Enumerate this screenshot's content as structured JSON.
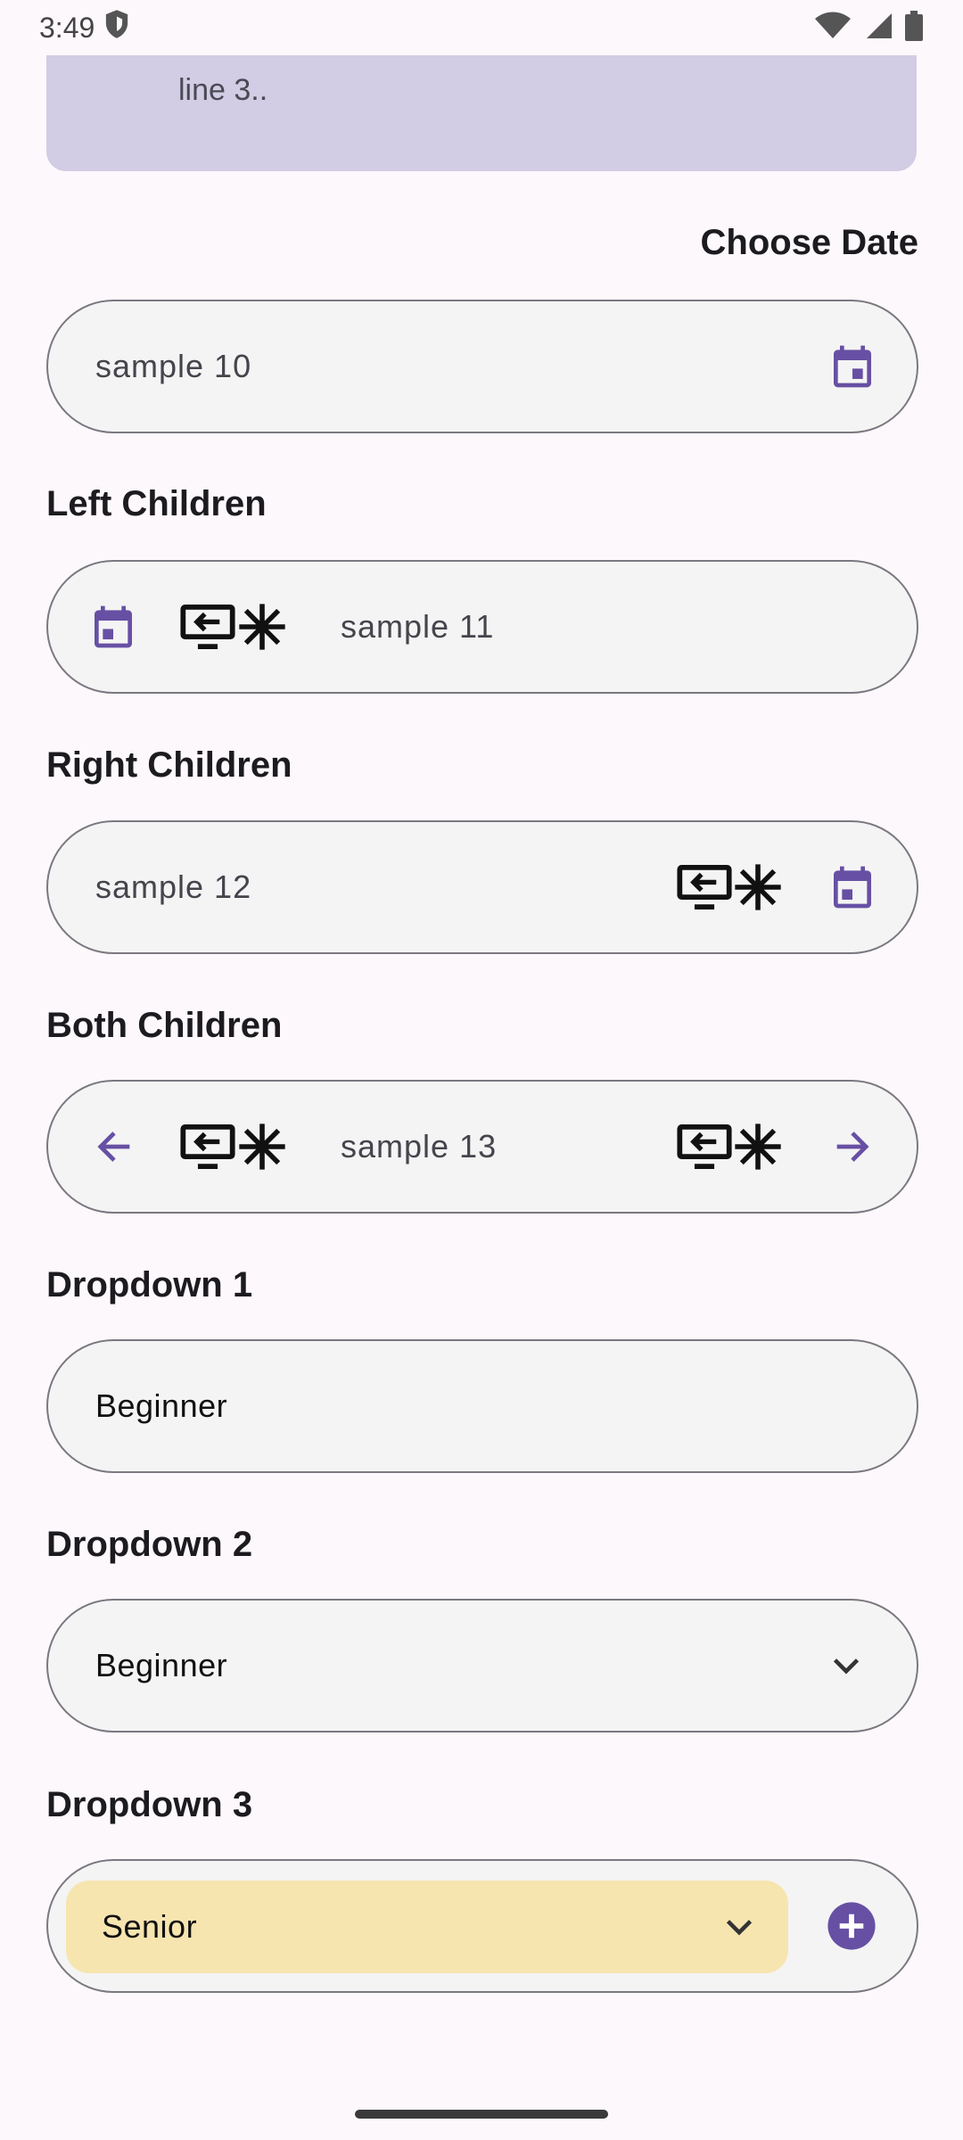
{
  "status_bar": {
    "time": "3:49",
    "icons": [
      "shield-icon",
      "wifi-icon",
      "signal-icon",
      "battery-icon"
    ]
  },
  "banner": {
    "text": "line 3.."
  },
  "choose_date": {
    "title": "Choose Date",
    "value": "sample 10",
    "right_icon": "calendar-icon"
  },
  "left_children": {
    "title": "Left Children",
    "value": "sample 11",
    "left_icons": [
      "calendar-icon",
      "screen-share-icon",
      "snowflake-icon"
    ]
  },
  "right_children": {
    "title": "Right Children",
    "value": "sample 12",
    "right_icons": [
      "screen-share-icon",
      "snowflake-icon",
      "calendar-icon"
    ]
  },
  "both_children": {
    "title": "Both Children",
    "value": "sample 13",
    "left_icons": [
      "arrow-back-icon",
      "screen-share-icon",
      "snowflake-icon"
    ],
    "right_icons": [
      "screen-share-icon",
      "snowflake-icon",
      "arrow-forward-icon"
    ]
  },
  "dropdown1": {
    "title": "Dropdown 1",
    "value": "Beginner"
  },
  "dropdown2": {
    "title": "Dropdown 2",
    "value": "Beginner",
    "icon": "chevron-down-icon"
  },
  "dropdown3": {
    "title": "Dropdown 3",
    "value": "Senior",
    "icons": [
      "chevron-down-icon",
      "add-circle-icon"
    ]
  },
  "colors": {
    "accent": "#6750a4",
    "banner": "#d2cce4",
    "dropdown_fill": "#f7e5b0",
    "field_fill": "#f4f4f4",
    "outline": "#7a7880"
  }
}
